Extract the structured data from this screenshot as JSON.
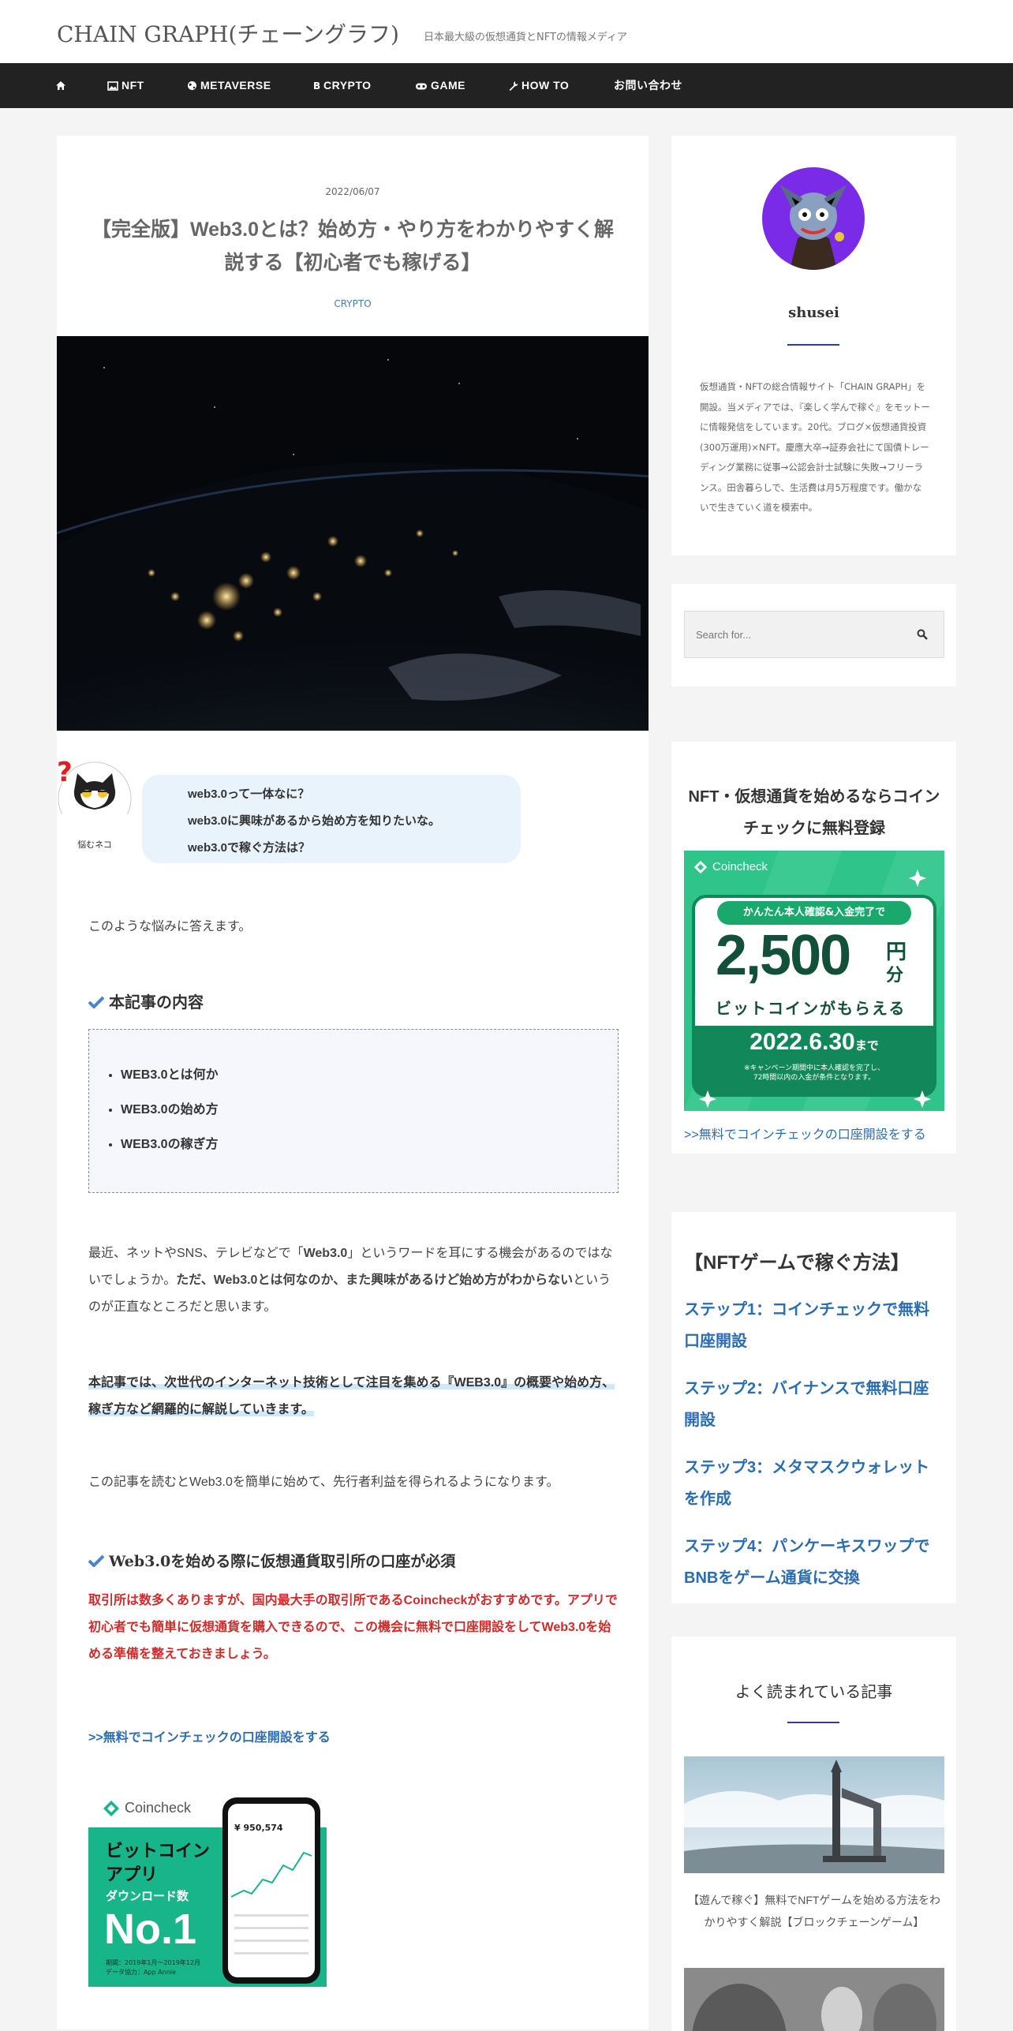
{
  "header": {
    "site_title": "CHAIN GRAPH(チェーングラフ)",
    "site_description": "日本最大級の仮想通貨とNFTの情報メディア"
  },
  "nav": {
    "items": [
      {
        "label": "",
        "icon": "home-icon"
      },
      {
        "label": "NFT",
        "icon": "image-icon"
      },
      {
        "label": "METAVERSE",
        "icon": "globe-icon"
      },
      {
        "label": "CRYPTO",
        "icon": "bitcoin-icon"
      },
      {
        "label": "GAME",
        "icon": "gamepad-icon"
      },
      {
        "label": "HOW TO",
        "icon": "wrench-icon"
      },
      {
        "label": "お問い合わせ",
        "icon": ""
      }
    ]
  },
  "article": {
    "date": "2022/06/07",
    "title": "【完全版】Web3.0とは？始め方・やり方をわかりやすく解説する【初心者でも稼げる】",
    "category": "CRYPTO",
    "balloon": {
      "avatar_label": "悩むネコ",
      "lines": [
        "web3.0って一体なに？",
        "web3.0に興味があるから始め方を知りたいな。",
        "web3.0で稼ぐ方法は？"
      ]
    },
    "intro": "このような悩みに答えます。",
    "toc_heading": "本記事の内容",
    "toc_items": [
      "WEB3.0とは何か",
      "WEB3.0の始め方",
      "WEB3.0の稼ぎ方"
    ],
    "para1_a": "最近、ネットやSNS、テレビなどで「",
    "para1_b": "Web3.0",
    "para1_c": "」というワードを耳にする機会があるのではないでしょうか。",
    "para1_d": "ただ、Web3.0とは何なのか、また興味があるけど始め方がわからない",
    "para1_e": "というのが正直なところだと思います。",
    "highlight": "本記事では、次世代のインターネット技術として注目を集める『WEB3.0』の概要や始め方、稼ぎ方など網羅的に解説していきます。",
    "para2": "この記事を読むとWeb3.0を簡単に始めて、先行者利益を得られるようになります。",
    "section_heading": "Web3.0を始める際に仮想通貨取引所の口座が必須",
    "red_text": "取引所は数多くありますが、国内最大手の取引所であるCoincheckがおすすめです。アプリで初心者でも簡単に仮想通貨を購入できるので、この機会に無料で口座開設をしてWeb3.0を始める準備を整えておきましょう。",
    "cta_link": ">>無料でコインチェックの口座開設をする",
    "ad": {
      "brand": "Coincheck",
      "line1": "ビットコイン",
      "line2": "アプリ",
      "line3": "ダウンロード数",
      "big": "No.1",
      "note1": "期間：2019年1月～2019年12月",
      "note2": "データ協力：App Annie",
      "phone_balance": "¥ 950,574"
    }
  },
  "sidebar": {
    "profile": {
      "name": "shusei",
      "bio": "仮想通貨・NFTの総合情報サイト「CHAIN GRAPH」を開設。当メディアでは、『楽しく学んで稼ぐ』をモットーに情報発信をしています。20代。ブログ×仮想通貨投資(300万運用)×NFT。慶應大卒→証券会社にて国債トレーディング業務に従事→公認会計士試験に失敗→フリーランス。田舎暮らしで、生活費は月5万程度です。働かないで生きていく道を模索中。"
    },
    "search": {
      "placeholder": "Search for..."
    },
    "promo": {
      "title": "NFT・仮想通貨を始めるならコインチェックに無料登録",
      "banner_brand": "Coincheck",
      "banner_pill": "かんたん本人確認&入金完了で",
      "banner_amount": "2,500",
      "banner_unit_top": "円",
      "banner_unit_bottom": "分",
      "banner_sub": "ビットコインがもらえる",
      "banner_date": "2022.6.30",
      "banner_date_suffix": "まで",
      "banner_note1": "※キャンペーン期間中に本人確認を完了し、",
      "banner_note2": "72時間以内の入金が条件となります。",
      "link": ">>無料でコインチェックの口座開設をする"
    },
    "nft_game": {
      "title": "【NFTゲームで稼ぐ方法】",
      "steps": [
        "ステップ1：コインチェックで無料口座開設",
        "ステップ2：バイナンスで無料口座開設",
        "ステップ3：メタマスクウォレットを作成",
        "ステップ4：パンケーキスワップでBNBをゲーム通貨に交換"
      ]
    },
    "popular": {
      "title": "よく読まれている記事",
      "posts": [
        {
          "title": "【遊んで稼ぐ】無料でNFTゲームを始める方法をわかりやすく解説【ブロックチェーンゲーム】"
        }
      ]
    }
  }
}
